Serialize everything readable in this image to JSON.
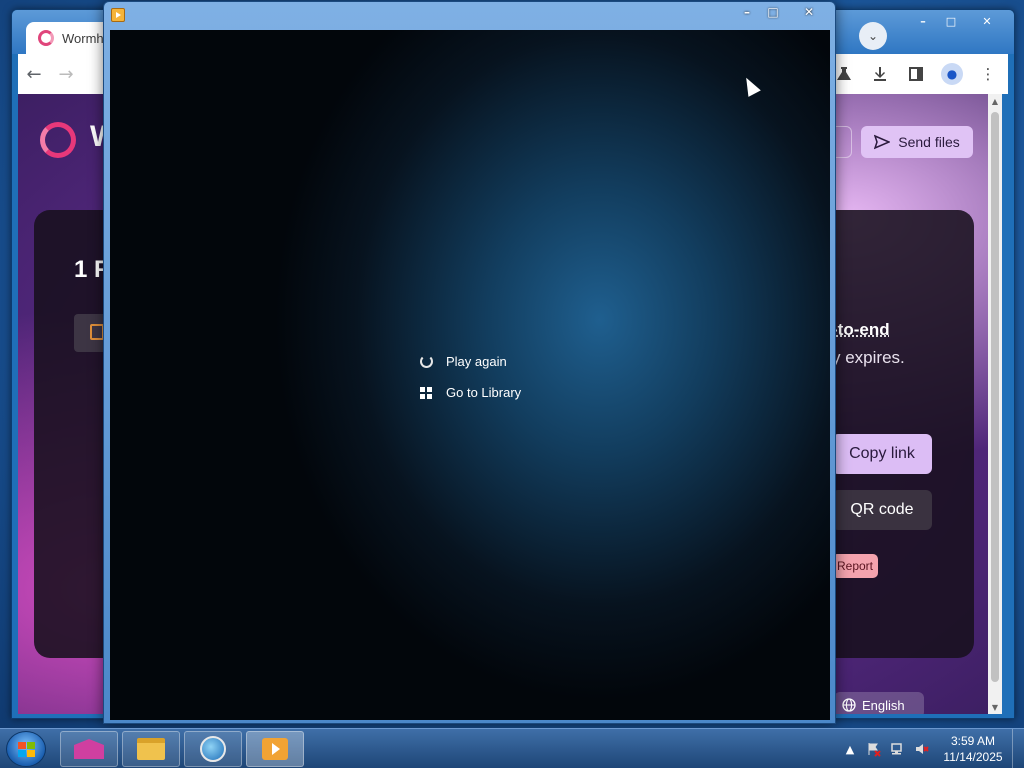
{
  "browser": {
    "tab_title": "Wormh",
    "tab_dropdown_icon": "chevron-down-icon",
    "controls": {
      "minimize": "–",
      "maximize": "□",
      "close": "✕"
    },
    "nav": {
      "back": "←",
      "forward": "→"
    },
    "toolbar_icons": [
      "labs-flask-icon",
      "download-icon",
      "side-panel-icon",
      "profile-icon",
      "menu-kebab-icon"
    ],
    "menu_glyph": "⋮"
  },
  "page": {
    "logo_letter": "W",
    "send_files_label": "Send files",
    "card_heading": "1 F",
    "e2e_text": "-to-end",
    "expires_text": "y expires.",
    "copy_link_label": "Copy link",
    "qr_code_label": "QR code",
    "report_label": "Report",
    "language_label": "English"
  },
  "player": {
    "controls": {
      "minimize": "–",
      "maximize": "□",
      "close": "✕"
    },
    "menu": [
      {
        "label": "Play again",
        "icon": "replay-icon"
      },
      {
        "label": "Go to Library",
        "icon": "library-icon"
      }
    ]
  },
  "taskbar": {
    "apps": [
      "wormhole-app",
      "file-explorer",
      "internet-explorer",
      "media-player"
    ],
    "clock_time": "3:59 AM",
    "clock_date": "11/14/2025",
    "tray_arrow": "▲"
  },
  "colors": {
    "accent_pink": "#e8387a",
    "send_files_bg": "#e0c3f5",
    "copy_link_bg": "#dcbdf5",
    "report_bg": "#f4a3ae",
    "windows_flag": [
      "#f35325",
      "#81bc06",
      "#05a6f0",
      "#ffba08"
    ]
  }
}
